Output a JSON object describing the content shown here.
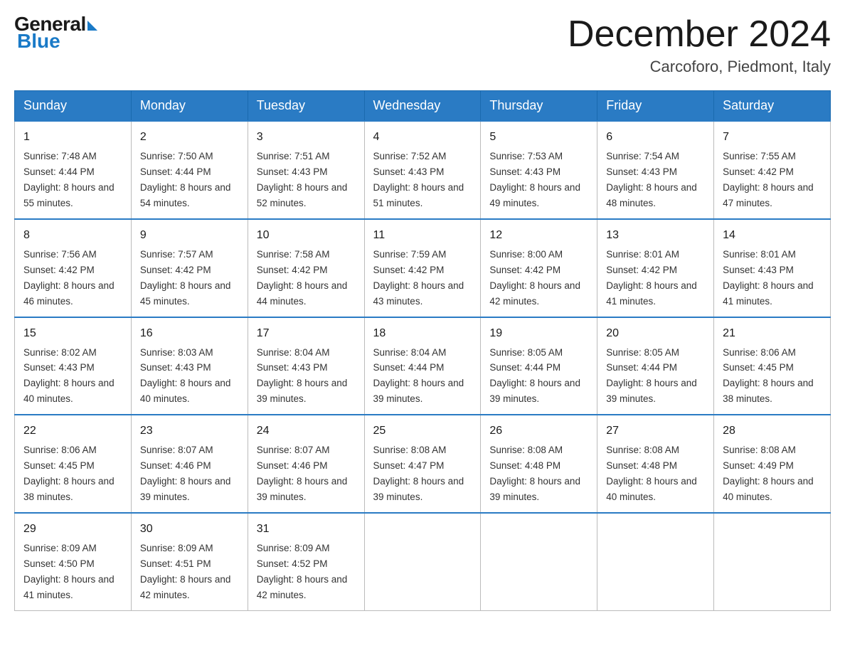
{
  "logo": {
    "general": "General",
    "blue": "Blue"
  },
  "title": {
    "month_year": "December 2024",
    "location": "Carcoforo, Piedmont, Italy"
  },
  "days_of_week": [
    "Sunday",
    "Monday",
    "Tuesday",
    "Wednesday",
    "Thursday",
    "Friday",
    "Saturday"
  ],
  "weeks": [
    [
      {
        "num": "1",
        "sunrise": "7:48 AM",
        "sunset": "4:44 PM",
        "daylight": "8 hours and 55 minutes."
      },
      {
        "num": "2",
        "sunrise": "7:50 AM",
        "sunset": "4:44 PM",
        "daylight": "8 hours and 54 minutes."
      },
      {
        "num": "3",
        "sunrise": "7:51 AM",
        "sunset": "4:43 PM",
        "daylight": "8 hours and 52 minutes."
      },
      {
        "num": "4",
        "sunrise": "7:52 AM",
        "sunset": "4:43 PM",
        "daylight": "8 hours and 51 minutes."
      },
      {
        "num": "5",
        "sunrise": "7:53 AM",
        "sunset": "4:43 PM",
        "daylight": "8 hours and 49 minutes."
      },
      {
        "num": "6",
        "sunrise": "7:54 AM",
        "sunset": "4:43 PM",
        "daylight": "8 hours and 48 minutes."
      },
      {
        "num": "7",
        "sunrise": "7:55 AM",
        "sunset": "4:42 PM",
        "daylight": "8 hours and 47 minutes."
      }
    ],
    [
      {
        "num": "8",
        "sunrise": "7:56 AM",
        "sunset": "4:42 PM",
        "daylight": "8 hours and 46 minutes."
      },
      {
        "num": "9",
        "sunrise": "7:57 AM",
        "sunset": "4:42 PM",
        "daylight": "8 hours and 45 minutes."
      },
      {
        "num": "10",
        "sunrise": "7:58 AM",
        "sunset": "4:42 PM",
        "daylight": "8 hours and 44 minutes."
      },
      {
        "num": "11",
        "sunrise": "7:59 AM",
        "sunset": "4:42 PM",
        "daylight": "8 hours and 43 minutes."
      },
      {
        "num": "12",
        "sunrise": "8:00 AM",
        "sunset": "4:42 PM",
        "daylight": "8 hours and 42 minutes."
      },
      {
        "num": "13",
        "sunrise": "8:01 AM",
        "sunset": "4:42 PM",
        "daylight": "8 hours and 41 minutes."
      },
      {
        "num": "14",
        "sunrise": "8:01 AM",
        "sunset": "4:43 PM",
        "daylight": "8 hours and 41 minutes."
      }
    ],
    [
      {
        "num": "15",
        "sunrise": "8:02 AM",
        "sunset": "4:43 PM",
        "daylight": "8 hours and 40 minutes."
      },
      {
        "num": "16",
        "sunrise": "8:03 AM",
        "sunset": "4:43 PM",
        "daylight": "8 hours and 40 minutes."
      },
      {
        "num": "17",
        "sunrise": "8:04 AM",
        "sunset": "4:43 PM",
        "daylight": "8 hours and 39 minutes."
      },
      {
        "num": "18",
        "sunrise": "8:04 AM",
        "sunset": "4:44 PM",
        "daylight": "8 hours and 39 minutes."
      },
      {
        "num": "19",
        "sunrise": "8:05 AM",
        "sunset": "4:44 PM",
        "daylight": "8 hours and 39 minutes."
      },
      {
        "num": "20",
        "sunrise": "8:05 AM",
        "sunset": "4:44 PM",
        "daylight": "8 hours and 39 minutes."
      },
      {
        "num": "21",
        "sunrise": "8:06 AM",
        "sunset": "4:45 PM",
        "daylight": "8 hours and 38 minutes."
      }
    ],
    [
      {
        "num": "22",
        "sunrise": "8:06 AM",
        "sunset": "4:45 PM",
        "daylight": "8 hours and 38 minutes."
      },
      {
        "num": "23",
        "sunrise": "8:07 AM",
        "sunset": "4:46 PM",
        "daylight": "8 hours and 39 minutes."
      },
      {
        "num": "24",
        "sunrise": "8:07 AM",
        "sunset": "4:46 PM",
        "daylight": "8 hours and 39 minutes."
      },
      {
        "num": "25",
        "sunrise": "8:08 AM",
        "sunset": "4:47 PM",
        "daylight": "8 hours and 39 minutes."
      },
      {
        "num": "26",
        "sunrise": "8:08 AM",
        "sunset": "4:48 PM",
        "daylight": "8 hours and 39 minutes."
      },
      {
        "num": "27",
        "sunrise": "8:08 AM",
        "sunset": "4:48 PM",
        "daylight": "8 hours and 40 minutes."
      },
      {
        "num": "28",
        "sunrise": "8:08 AM",
        "sunset": "4:49 PM",
        "daylight": "8 hours and 40 minutes."
      }
    ],
    [
      {
        "num": "29",
        "sunrise": "8:09 AM",
        "sunset": "4:50 PM",
        "daylight": "8 hours and 41 minutes."
      },
      {
        "num": "30",
        "sunrise": "8:09 AM",
        "sunset": "4:51 PM",
        "daylight": "8 hours and 42 minutes."
      },
      {
        "num": "31",
        "sunrise": "8:09 AM",
        "sunset": "4:52 PM",
        "daylight": "8 hours and 42 minutes."
      },
      null,
      null,
      null,
      null
    ]
  ]
}
